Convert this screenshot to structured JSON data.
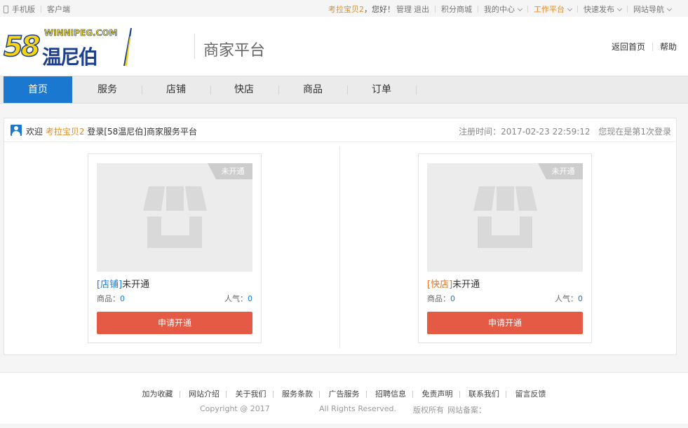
{
  "topbar": {
    "mobile": "手机版",
    "client": "客户端",
    "username": "考拉宝贝2",
    "hello": "，您好！",
    "manage": "管理",
    "logout": "退出",
    "points_mall": "积分商城",
    "my_center": "我的中心",
    "work_platform": "工作平台",
    "quick_post": "快速发布",
    "site_nav": "网站导航"
  },
  "header": {
    "logo_num": "58",
    "logo_latin": "WINNIPEG.COM",
    "logo_cn": "温尼伯",
    "platform_title": "商家平台",
    "back_home": "返回首页",
    "help": "帮助"
  },
  "nav": {
    "tabs": [
      {
        "label": "首页"
      },
      {
        "label": "服务"
      },
      {
        "label": "店铺"
      },
      {
        "label": "快店"
      },
      {
        "label": "商品"
      },
      {
        "label": "订单"
      }
    ]
  },
  "welcome": {
    "prefix": "欢迎",
    "username": "考拉宝贝2",
    "suffix": "登录[58温尼伯]商家服务平台",
    "reg_time": "注册时间：2017-02-23 22:59:12",
    "login_count": "您现在是第1次登录"
  },
  "cards": [
    {
      "ribbon": "未开通",
      "tag": "[店铺]",
      "status": "未开通",
      "goods_label": "商品：",
      "goods_value": "0",
      "popularity_label": "人气：",
      "popularity_value": "0",
      "button": "申请开通"
    },
    {
      "ribbon": "未开通",
      "tag": "[快店]",
      "status": "未开通",
      "goods_label": "商品：",
      "goods_value": "0",
      "popularity_label": "人气：",
      "popularity_value": "0",
      "button": "申请开通"
    }
  ],
  "footer": {
    "links": [
      "加为收藏",
      "网站介绍",
      "关于我们",
      "服务条款",
      "广告服务",
      "招聘信息",
      "免责声明",
      "联系我们",
      "留言反馈"
    ],
    "copyright": "Copyright @ 2017",
    "rights": "All Rights Reserved.",
    "owner": "版权所有",
    "icp": "网站备案："
  },
  "colors": {
    "accent_blue": "#1a78d0",
    "accent_orange": "#e48c25",
    "button_red": "#e55a45",
    "logo_yellow": "#f7d515",
    "logo_navy": "#1d3f8c"
  },
  "icons": {
    "phone": "mobile-phone-icon",
    "user": "user-avatar-icon",
    "store": "storefront-icon",
    "chevron": "chevron-down-icon"
  }
}
